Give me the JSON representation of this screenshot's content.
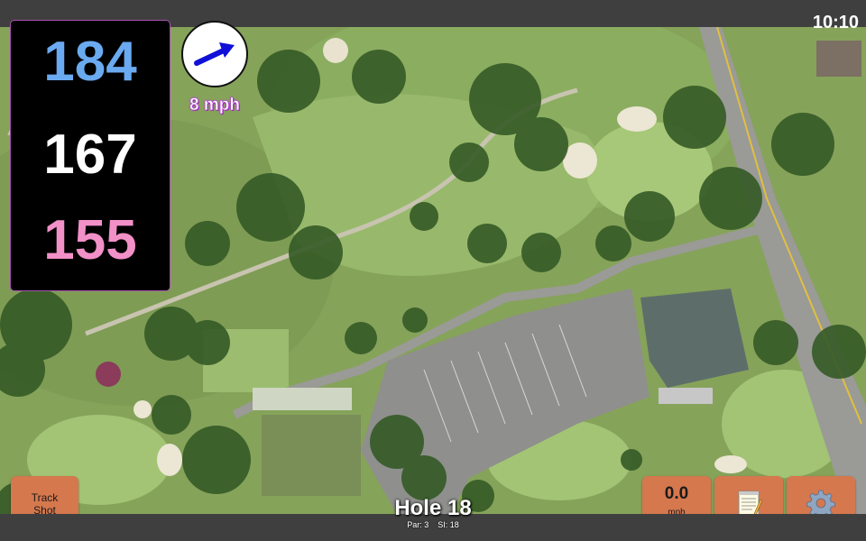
{
  "status": {
    "time": "10:10"
  },
  "yardages": {
    "back": "184",
    "middle": "167",
    "front": "155"
  },
  "wind": {
    "speed_label": "8 mph"
  },
  "hole": {
    "title": "Hole 18",
    "par_si": "Par: 3    SI: 18"
  },
  "buttons": {
    "track_shot_line1": "Track",
    "track_shot_line2": "Shot",
    "wind_value": "0.0",
    "wind_unit": "mph"
  },
  "colors": {
    "back": "#6aaaf0",
    "middle": "#ffffff",
    "front": "#f290c8",
    "button": "#d5784e",
    "wind_arrow": "#1010d8"
  },
  "icons": {
    "wind_arrow": "arrow-icon",
    "notes": "notepad-icon",
    "settings": "gear-icon"
  }
}
